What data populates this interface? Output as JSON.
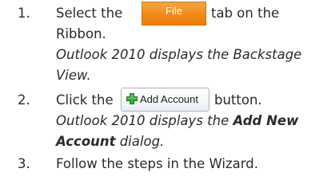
{
  "steps": [
    {
      "number": "1.",
      "before_button": "Select the",
      "button_label": "File",
      "after_button": "tab on the",
      "continuation": "Ribbon.",
      "note_line1": "Outlook 2010 displays the Backstage",
      "note_line2": "View."
    },
    {
      "number": "2.",
      "before_button": "Click the",
      "button_label": "Add Account",
      "button_icon": "green-plus-icon",
      "after_button": "button.",
      "note_line1_prefix": "Outlook 2010 displays the ",
      "note_line1_bold": "Add New",
      "note_line2_bold": "Account",
      "note_line2_suffix": " dialog."
    },
    {
      "number": "3.",
      "text": "Follow the steps in the Wizard."
    }
  ],
  "colors": {
    "file_tab": "#f28a18",
    "plus_icon": "#2f9e2f",
    "text": "#2b2b2b"
  }
}
